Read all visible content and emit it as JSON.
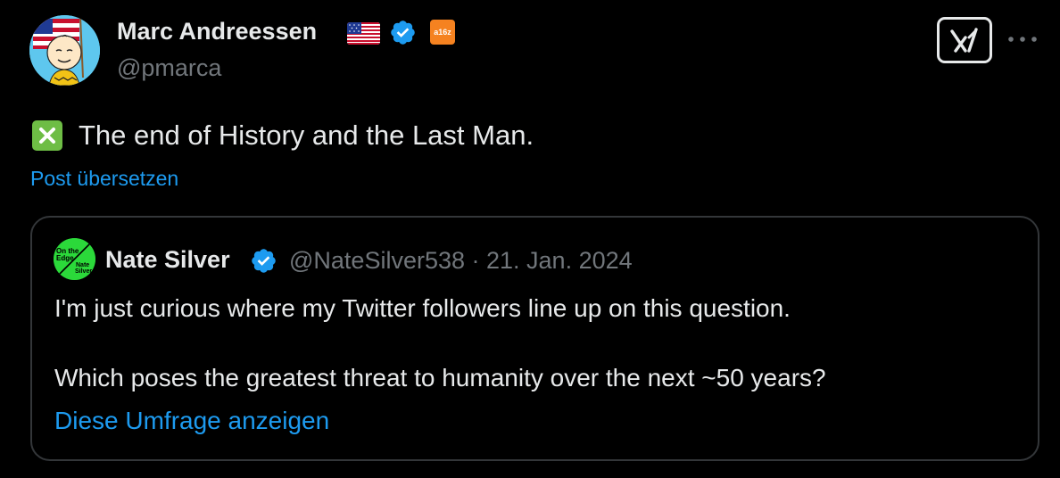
{
  "post": {
    "author": {
      "name": "Marc Andreessen",
      "handle": "@pmarca",
      "flag_icon": "us-flag-icon",
      "verified_icon": "verified-badge-icon",
      "affiliate_badge": "a16z",
      "avatar": "avatar"
    },
    "text": "The end of History and the Last Man.",
    "leading_icon": "cross-mark-icon",
    "translate_label": "Post übersetzen",
    "actions": {
      "grok_icon": "grok-icon",
      "more_icon": "more-icon"
    }
  },
  "quote": {
    "author": {
      "name": "Nate Silver",
      "avatar_text": [
        "On the",
        "Edge",
        "Nate",
        "Silver"
      ]
    },
    "meta": "@NateSilver538 · 21. Jan. 2024",
    "line1": "I'm just curious where my Twitter followers line up on this question.",
    "line2": "Which poses the greatest threat to humanity over the next ~50 years?",
    "poll_link": "Diese Umfrage anzeigen"
  },
  "colors": {
    "background": "#000000",
    "text": "#e7e9ea",
    "muted": "#71767b",
    "link": "#1d9bf0",
    "verified": "#1d9bf0",
    "border": "#333639",
    "cross_icon": "#6ebd45",
    "affiliate": "#f58220"
  }
}
